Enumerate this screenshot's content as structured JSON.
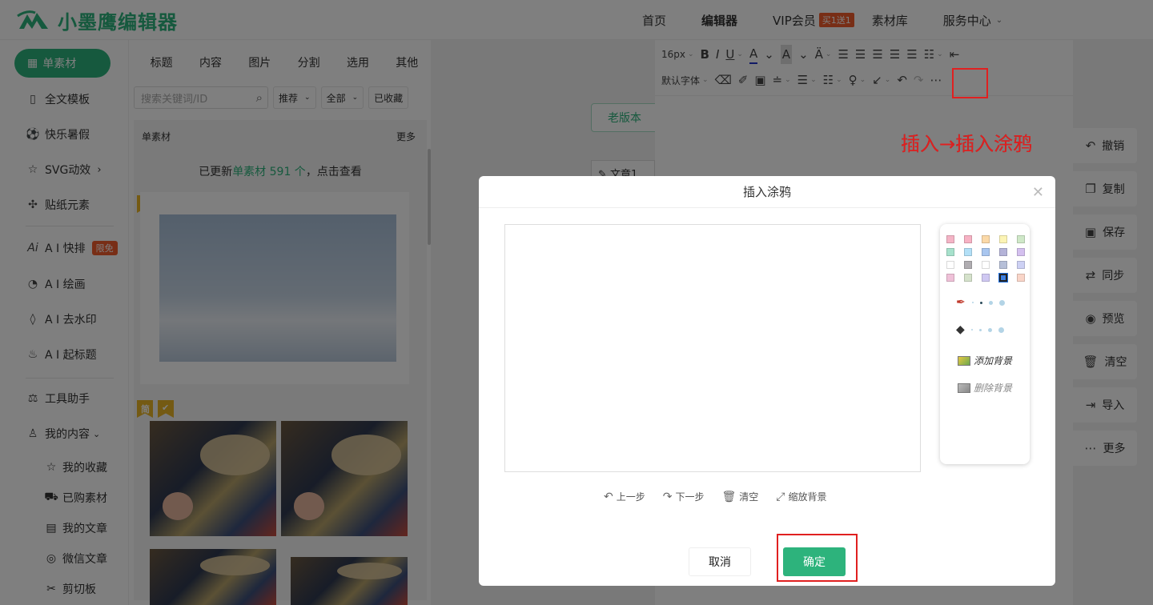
{
  "header": {
    "logo_text": "小墨鹰编辑器",
    "nav": [
      "首页",
      "编辑器",
      "VIP会员",
      "素材库",
      "服务中心"
    ],
    "vip_badge": "买1送1"
  },
  "sidebar": {
    "active": "单素材",
    "items": [
      "全文模板",
      "快乐暑假",
      "SVG动效",
      "贴纸元素",
      "A I 快排",
      "A I 绘画",
      "A I 去水印",
      "A I 起标题",
      "工具助手",
      "我的内容"
    ],
    "ai_tag": "限免",
    "sub_items": [
      "我的收藏",
      "已购素材",
      "我的文章",
      "微信文章",
      "剪切板"
    ]
  },
  "panel": {
    "tabs": [
      "标题",
      "内容",
      "图片",
      "分割",
      "选用",
      "其他"
    ],
    "search_placeholder": "搜索关键词/ID",
    "filters": [
      "推荐",
      "全部",
      "已收藏"
    ],
    "section_title": "单素材",
    "more": "更多",
    "updated_prefix": "已更新",
    "updated_highlight": "单素材 591 个",
    "updated_suffix": "，点击查看",
    "flag_label": "简"
  },
  "editor": {
    "old_version": "老版本",
    "doc_tab": "文章1",
    "font_size": "16px",
    "font_family": "默认字体",
    "hint": "插入→插入涂鸦"
  },
  "right_actions": [
    "撤销",
    "复制",
    "保存",
    "同步",
    "预览",
    "清空",
    "导入",
    "更多"
  ],
  "modal": {
    "title": "插入涂鸦",
    "palette_colors": [
      [
        "#f4b4c6",
        "#f7b2c4",
        "#fbd9a8",
        "#fcf4b5",
        "#cfe8c8"
      ],
      [
        "#a7e1cc",
        "#b3e0f7",
        "#a9c6ef",
        "#b4b3d8",
        "#d4c0ef"
      ],
      [
        "#ffffff",
        "#b0adb1",
        "#ffffff",
        "#b6bfd8",
        "#cdd1f4"
      ],
      [
        "#efc1d8",
        "#d5e2cb",
        "#cfc8f2",
        "#3c7fe0",
        "#f9d5c8"
      ]
    ],
    "selected_color": "#3c7fe0",
    "add_bg": "添加背景",
    "remove_bg": "删除背景",
    "actions": [
      "上一步",
      "下一步",
      "清空",
      "缩放背景"
    ],
    "cancel": "取消",
    "confirm": "确定"
  }
}
